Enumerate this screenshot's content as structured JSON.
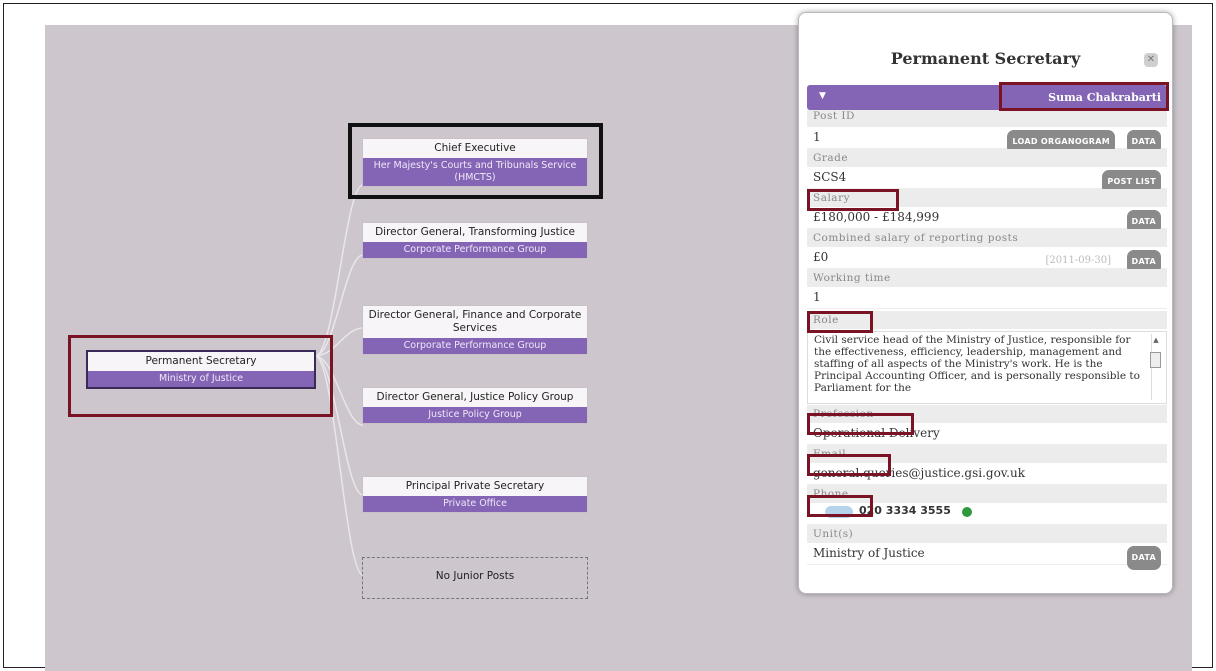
{
  "org_chart": {
    "root": {
      "title": "Permanent Secretary",
      "org": "Ministry of Justice"
    },
    "children": [
      {
        "title": "Chief Executive",
        "org": "Her Majesty's Courts and Tribunals Service (HMCTS)"
      },
      {
        "title": "Director General, Transforming Justice",
        "org": "Corporate Performance Group"
      },
      {
        "title": "Director General, Finance and Corporate Services",
        "org": "Corporate Performance Group"
      },
      {
        "title": "Director General, Justice Policy Group",
        "org": "Justice Policy Group"
      },
      {
        "title": "Principal Private Secretary",
        "org": "Private Office"
      }
    ],
    "no_junior": "No Junior Posts"
  },
  "panel": {
    "title": "Permanent Secretary",
    "close": "✕",
    "person_name": "Suma Chakrabarti",
    "post_id_label": "Post ID",
    "post_id": "1",
    "load_organogram": "LOAD ORGANOGRAM",
    "data_label": "DATA",
    "grade_label": "Grade",
    "grade": "SCS4",
    "post_list": "POST LIST",
    "salary_label": "Salary",
    "salary": "£180,000 - £184,999",
    "combined_label": "Combined salary of reporting posts",
    "combined": "£0",
    "combined_date": "[2011-09-30]",
    "working_label": "Working time",
    "working": "1",
    "role_label": "Role",
    "role": "Civil service head of the Ministry of Justice, responsible for the effectiveness, efficiency, leadership, management and staffing of all aspects of the Ministry's work. He is the Principal Accounting Officer, and is personally responsible to Parliament for the",
    "profession_label": "Profession",
    "profession": "Operational Delivery",
    "email_label": "Email",
    "email": "general.queries@justice.gsi.gov.uk",
    "phone_label": "Phone",
    "phone": "020 3334 3555",
    "units_label": "Unit(s)",
    "units": "Ministry of Justice"
  }
}
